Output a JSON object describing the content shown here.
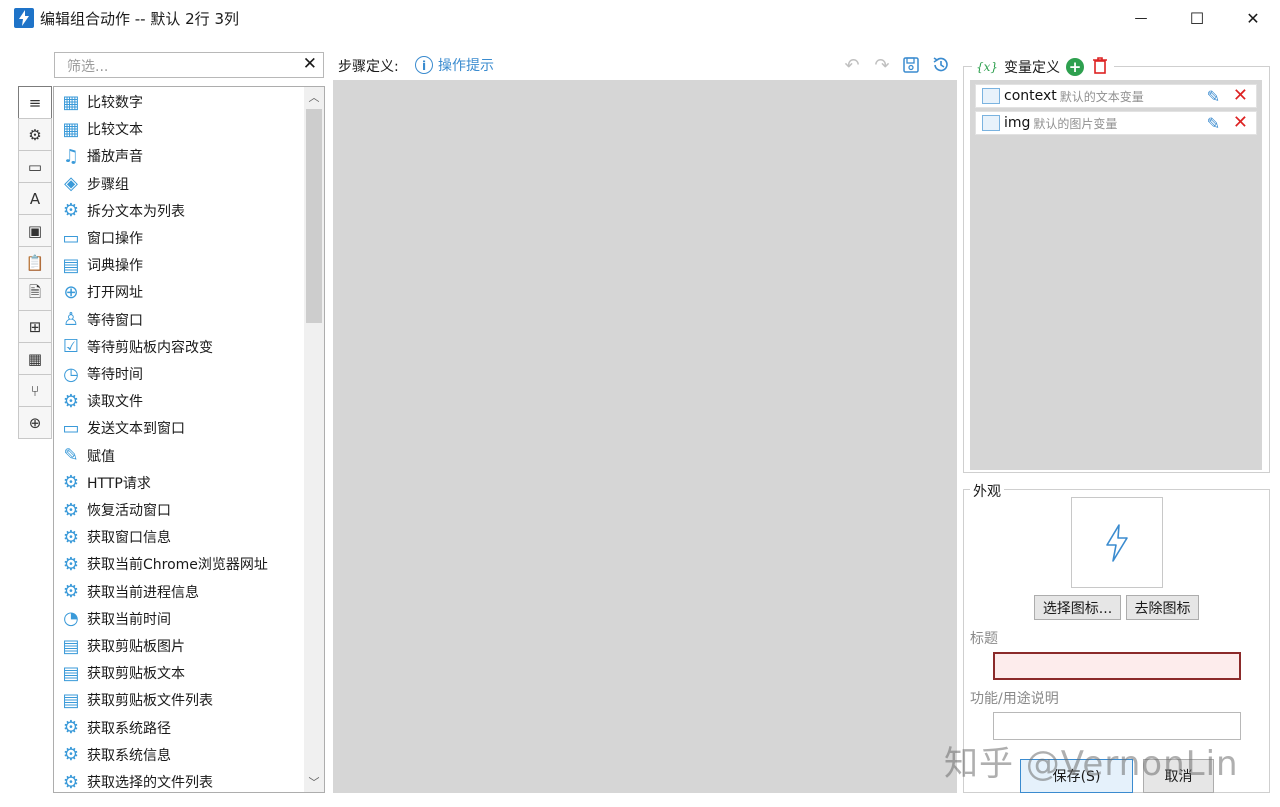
{
  "window": {
    "title": "编辑组合动作 -- 默认 2行 3列",
    "minimize": "—",
    "maximize": "☐",
    "close": "✕"
  },
  "filter": {
    "placeholder": "筛选...",
    "clear": "✕"
  },
  "side_tabs": [
    {
      "icon": "list-icon",
      "glyph": "≡"
    },
    {
      "icon": "gear-icon",
      "glyph": "⚙"
    },
    {
      "icon": "window-icon",
      "glyph": "▭"
    },
    {
      "icon": "font-icon",
      "glyph": "A"
    },
    {
      "icon": "image-icon",
      "glyph": "▣"
    },
    {
      "icon": "clipboard-icon",
      "glyph": "📋"
    },
    {
      "icon": "document-icon",
      "glyph": "🗎"
    },
    {
      "icon": "windows-icon",
      "glyph": "⊞"
    },
    {
      "icon": "calculator-icon",
      "glyph": "▦"
    },
    {
      "icon": "branch-icon",
      "glyph": "⑂"
    },
    {
      "icon": "globe-icon",
      "glyph": "⊕"
    }
  ],
  "actions": [
    {
      "label": "比较数字",
      "icon": "compare-icon",
      "glyph": "▦"
    },
    {
      "label": "比较文本",
      "icon": "compare-icon",
      "glyph": "▦"
    },
    {
      "label": "播放声音",
      "icon": "music-icon",
      "glyph": "♫"
    },
    {
      "label": "步骤组",
      "icon": "layers-icon",
      "glyph": "◈"
    },
    {
      "label": "拆分文本为列表",
      "icon": "gear-icon",
      "glyph": "⚙"
    },
    {
      "label": "窗口操作",
      "icon": "window-icon",
      "glyph": "▭"
    },
    {
      "label": "词典操作",
      "icon": "book-icon",
      "glyph": "▤"
    },
    {
      "label": "打开网址",
      "icon": "globe-icon",
      "glyph": "⊕"
    },
    {
      "label": "等待窗口",
      "icon": "user-icon",
      "glyph": "♙"
    },
    {
      "label": "等待剪贴板内容改变",
      "icon": "clipboard-icon",
      "glyph": "☑"
    },
    {
      "label": "等待时间",
      "icon": "timer-icon",
      "glyph": "◷"
    },
    {
      "label": "读取文件",
      "icon": "gear-icon",
      "glyph": "⚙"
    },
    {
      "label": "发送文本到窗口",
      "icon": "message-icon",
      "glyph": "▭"
    },
    {
      "label": "赋值",
      "icon": "edit-icon",
      "glyph": "✎"
    },
    {
      "label": "HTTP请求",
      "icon": "gear-icon",
      "glyph": "⚙"
    },
    {
      "label": "恢复活动窗口",
      "icon": "gear-icon",
      "glyph": "⚙"
    },
    {
      "label": "获取窗口信息",
      "icon": "gear-icon",
      "glyph": "⚙"
    },
    {
      "label": "获取当前Chrome浏览器网址",
      "icon": "gear-icon",
      "glyph": "⚙"
    },
    {
      "label": "获取当前进程信息",
      "icon": "gear-icon",
      "glyph": "⚙"
    },
    {
      "label": "获取当前时间",
      "icon": "clock-icon",
      "glyph": "◔"
    },
    {
      "label": "获取剪贴板图片",
      "icon": "clipboard-icon",
      "glyph": "▤"
    },
    {
      "label": "获取剪贴板文本",
      "icon": "clipboard-icon",
      "glyph": "▤"
    },
    {
      "label": "获取剪贴板文件列表",
      "icon": "clipboard-icon",
      "glyph": "▤"
    },
    {
      "label": "获取系统路径",
      "icon": "gear-icon",
      "glyph": "⚙"
    },
    {
      "label": "获取系统信息",
      "icon": "gear-icon",
      "glyph": "⚙"
    },
    {
      "label": "获取选择的文件列表",
      "icon": "gear-icon",
      "glyph": "⚙"
    }
  ],
  "steps": {
    "label": "步骤定义:",
    "hint": "操作提示",
    "hint_glyph": "i"
  },
  "toolbar": {
    "undo": "↶",
    "redo": "↷",
    "save": "💾",
    "history": "↺"
  },
  "variables": {
    "header": "变量定义",
    "badge": "{x}",
    "add": "+",
    "items": [
      {
        "name": "context",
        "desc": "默认的文本变量",
        "icon": "text-variable-icon"
      },
      {
        "name": "img",
        "desc": "默认的图片变量",
        "icon": "image-variable-icon"
      }
    ]
  },
  "appearance": {
    "label": "外观",
    "choose_icon": "选择图标...",
    "remove_icon": "去除图标",
    "title_label": "标题",
    "title_value": "",
    "desc_label": "功能/用途说明",
    "desc_value": ""
  },
  "buttons": {
    "save": "保存(S)",
    "cancel": "取消"
  },
  "watermark": "知乎 @VernonLin",
  "colors": {
    "accent": "#3a8bcf",
    "danger": "#dd2222",
    "add": "#2ea04f",
    "canvas": "#d6d6d6"
  }
}
